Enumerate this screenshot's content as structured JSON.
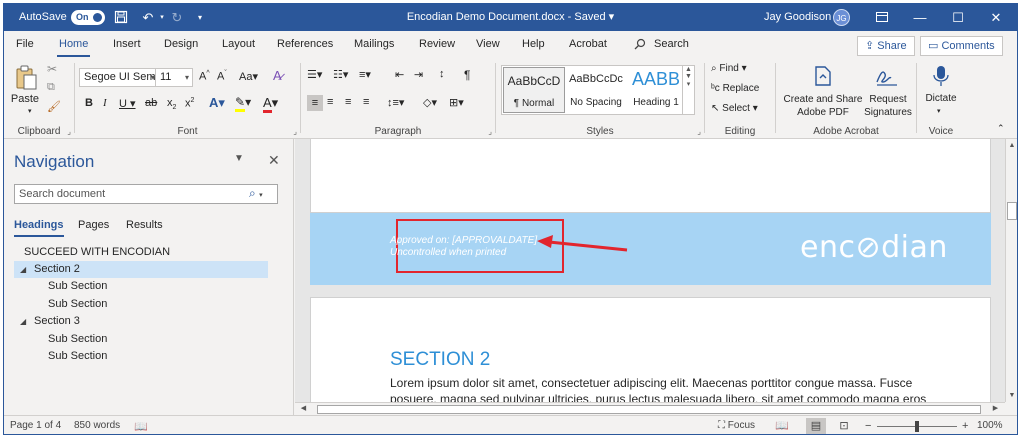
{
  "titlebar": {
    "autosave_label": "AutoSave",
    "autosave_state": "On",
    "doc_title": "Encodian Demo Document.docx  -  Saved  ▾",
    "user_name": "Jay Goodison",
    "user_initials": "JG",
    "bg_color": "#2b579a"
  },
  "menu": {
    "tabs": [
      "File",
      "Home",
      "Insert",
      "Design",
      "Layout",
      "References",
      "Mailings",
      "Review",
      "View",
      "Help",
      "Acrobat"
    ],
    "active_tab": "Home",
    "search_label": "Search",
    "share_label": "Share",
    "comments_label": "Comments"
  },
  "ribbon": {
    "clipboard": {
      "paste_label": "Paste",
      "group_label": "Clipboard"
    },
    "font": {
      "font_name": "Segoe UI Semi",
      "font_size": "11",
      "group_label": "Font"
    },
    "paragraph": {
      "group_label": "Paragraph"
    },
    "styles": {
      "group_label": "Styles",
      "tiles": [
        {
          "sample": "AaBbCcD",
          "name": "¶ Normal"
        },
        {
          "sample": "AaBbCcDc",
          "name": "No Spacing"
        },
        {
          "sample": "AABB",
          "name": "Heading 1"
        }
      ]
    },
    "editing": {
      "find_label": "Find",
      "replace_label": "Replace",
      "select_label": "Select",
      "group_label": "Editing"
    },
    "acrobat": {
      "create_line1": "Create and Share",
      "create_line2": "Adobe PDF",
      "request_line1": "Request",
      "request_line2": "Signatures",
      "group_label": "Adobe Acrobat"
    },
    "voice": {
      "dictate_label": "Dictate",
      "group_label": "Voice"
    }
  },
  "navigation": {
    "title": "Navigation",
    "search_placeholder": "Search document",
    "tabs": [
      "Headings",
      "Pages",
      "Results"
    ],
    "active_tab": "Headings",
    "headings": [
      {
        "label": "SUCCEED WITH ENCODIAN",
        "level": 1,
        "expanded": null,
        "selected": false
      },
      {
        "label": "Section 2",
        "level": 1,
        "expanded": true,
        "selected": true
      },
      {
        "label": "Sub Section",
        "level": 2,
        "expanded": null,
        "selected": false
      },
      {
        "label": "Sub Section",
        "level": 2,
        "expanded": null,
        "selected": false
      },
      {
        "label": "Section 3",
        "level": 1,
        "expanded": true,
        "selected": false
      },
      {
        "label": "Sub Section",
        "level": 2,
        "expanded": null,
        "selected": false
      },
      {
        "label": "Sub Section",
        "level": 2,
        "expanded": null,
        "selected": false
      }
    ]
  },
  "document": {
    "approval_line1": "Approved on: [APPROVALDATE]",
    "approval_line2": "Uncontrolled when printed",
    "logo_text": "enc⊘dian",
    "section_heading": "SECTION 2",
    "body_line1": "Lorem ipsum dolor sit amet, consectetuer adipiscing elit. Maecenas porttitor congue massa. Fusce",
    "body_line2": "posuere, magna sed pulvinar ultricies, purus lectus malesuada libero, sit amet commodo magna eros",
    "header_band_color": "#a7d4f4",
    "highlight_color": "#e2252d",
    "heading_color": "#2e8fd6"
  },
  "statusbar": {
    "page_info": "Page 1 of 4",
    "word_count": "850 words",
    "focus_label": "Focus",
    "zoom_minus": "−",
    "zoom_plus": "+",
    "zoom_level": "100%"
  }
}
